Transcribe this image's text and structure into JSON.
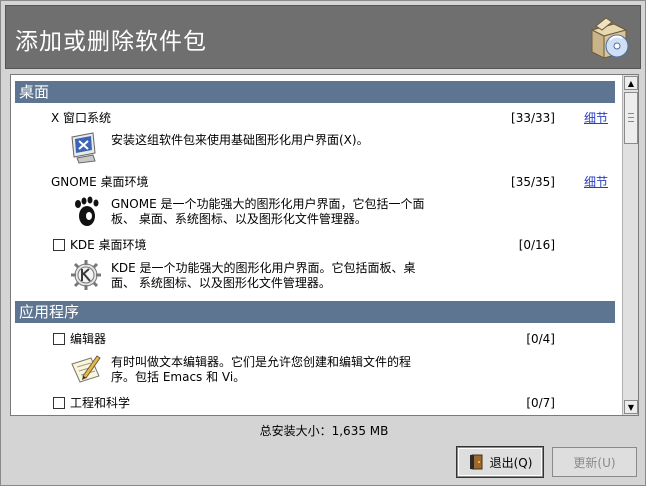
{
  "window": {
    "title": "添加或删除软件包",
    "banner_icon": "package-box-cd-icon"
  },
  "categories": [
    {
      "label": "桌面",
      "packages": [
        {
          "name": "X 窗口系统",
          "count": "[33/33]",
          "link": "细节",
          "checked": true,
          "description": "安装这组软件包来使用基础图形化用户界面(X)。",
          "icon": "monitor-x-icon"
        },
        {
          "name": "GNOME 桌面环境",
          "count": "[35/35]",
          "link": "细节",
          "checked": true,
          "description_lines": [
            "GNOME 是一个功能强大的图形化用户界面，它包括一个面",
            "板、 桌面、系统图标、以及图形化文件管理器。"
          ],
          "icon": "gnome-foot-icon"
        },
        {
          "name": "KDE 桌面环境",
          "count": "[0/16]",
          "checked": false,
          "description_lines": [
            "KDE 是一个功能强大的图形化用户界面。它包括面板、桌",
            "面、 系统图标、以及图形化文件管理器。"
          ],
          "icon": "kde-gear-icon"
        }
      ]
    },
    {
      "label": "应用程序",
      "packages": [
        {
          "name": "编辑器",
          "count": "[0/4]",
          "checked": false,
          "description_lines": [
            "有时叫做文本编辑器。它们是允许您创建和编辑文件的程",
            "序。包括 Emacs 和 Vi。"
          ],
          "icon": "notepad-pencil-icon"
        },
        {
          "name": "工程和科学",
          "count": "[0/7]",
          "checked": false
        }
      ]
    }
  ],
  "footer": {
    "total_size": "总安装大小：1,635 MB",
    "quit_label": "退出(Q)",
    "update_label": "更新(U)"
  }
}
